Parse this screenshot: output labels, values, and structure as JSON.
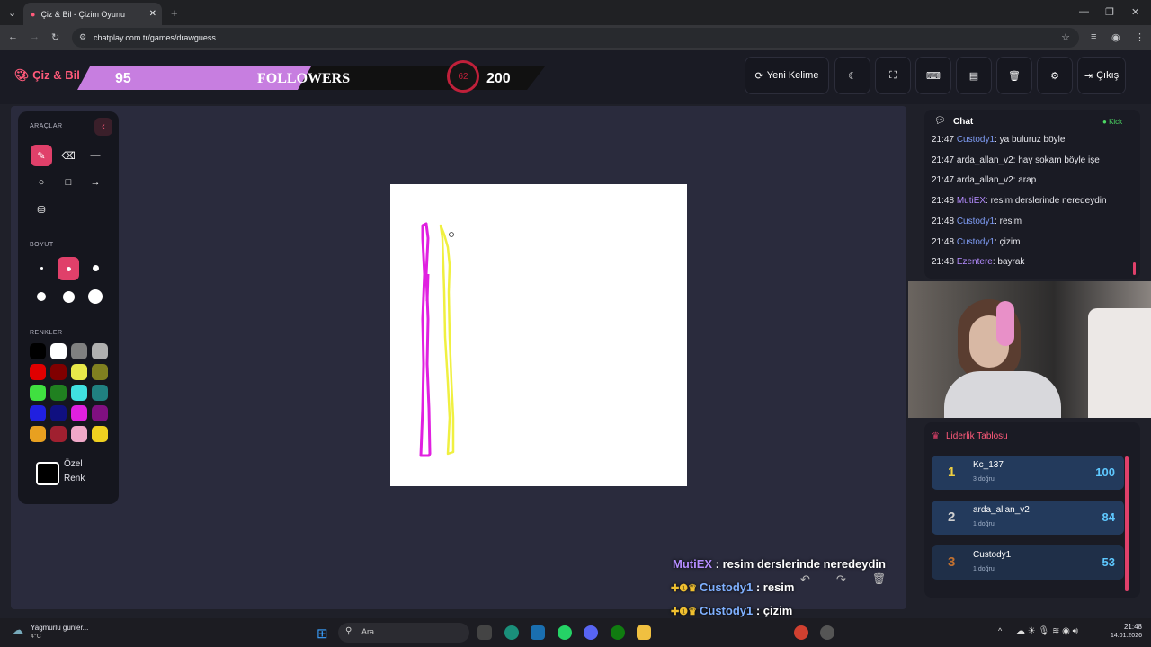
{
  "browser": {
    "tab_title": "Çiz & Bil - Çizim Oyunu",
    "url": "chatplay.com.tr/games/drawguess"
  },
  "header": {
    "logo": "Çiz & Bil",
    "followers_count": "95",
    "followers_label": "FOLLOWERS",
    "timer": "62",
    "goal": "200",
    "new_word_label": "Yeni Kelime",
    "exit_label": "Çıkış"
  },
  "tools": {
    "title": "ARAÇLAR",
    "size_title": "BOYUT",
    "colors_title": "RENKLER",
    "custom_color_line1": "Özel",
    "custom_color_line2": "Renk",
    "palette": [
      "#000000",
      "#ffffff",
      "#808080",
      "#b0b0b0",
      "#e00000",
      "#800000",
      "#e8e84a",
      "#808020",
      "#40e040",
      "#208020",
      "#40e0e0",
      "#208080",
      "#2020e0",
      "#101080",
      "#e020e0",
      "#801080",
      "#e8a020",
      "#a02030",
      "#f0a8c8",
      "#f0d020"
    ]
  },
  "chat": {
    "title": "Chat",
    "platform": "Kick",
    "messages": [
      {
        "time": "21:47",
        "user": "Custody1",
        "user_color": "#7f9cf5",
        "text": "ya buluruz böyle"
      },
      {
        "time": "21:47",
        "user": "arda_allan_v2",
        "user_color": "#e8e8ee",
        "text": "hay sokam böyle işe"
      },
      {
        "time": "21:47",
        "user": "arda_allan_v2",
        "user_color": "#e8e8ee",
        "text": "arap"
      },
      {
        "time": "21:48",
        "user": "MutiEX",
        "user_color": "#b48cff",
        "text": "resim derslerinde neredeydin"
      },
      {
        "time": "21:48",
        "user": "Custody1",
        "user_color": "#7f9cf5",
        "text": "resim"
      },
      {
        "time": "21:48",
        "user": "Custody1",
        "user_color": "#7f9cf5",
        "text": "çizim"
      },
      {
        "time": "21:48",
        "user": "Ezentere",
        "user_color": "#b48cff",
        "text": "bayrak"
      }
    ]
  },
  "leaderboard": {
    "title": "Liderlik Tablosu",
    "rows": [
      {
        "rank": "1",
        "name": "Kc_137",
        "sub": "3 doğru",
        "score": "100"
      },
      {
        "rank": "2",
        "name": "arda_allan_v2",
        "sub": "1 doğru",
        "score": "84"
      },
      {
        "rank": "3",
        "name": "Custody1",
        "sub": "1 doğru",
        "score": "53"
      }
    ]
  },
  "overlay_chat": [
    {
      "user": "MutiEX",
      "user_color": "#b48cff",
      "text": ": resim derslerinde neredeydin"
    },
    {
      "user": "Custody1",
      "user_color": "#7fb0ff",
      "text": ": resim"
    },
    {
      "user": "Custody1",
      "user_color": "#7fb0ff",
      "text": ": çizim"
    },
    {
      "user": "Ezentere",
      "user_color": "#b48cff",
      "text": ": bayrak"
    }
  ],
  "taskbar": {
    "weather": "Yağmurlu günler...",
    "temp": "4°C",
    "search": "Ara",
    "time": "21:48",
    "date": "14.01.2026"
  }
}
